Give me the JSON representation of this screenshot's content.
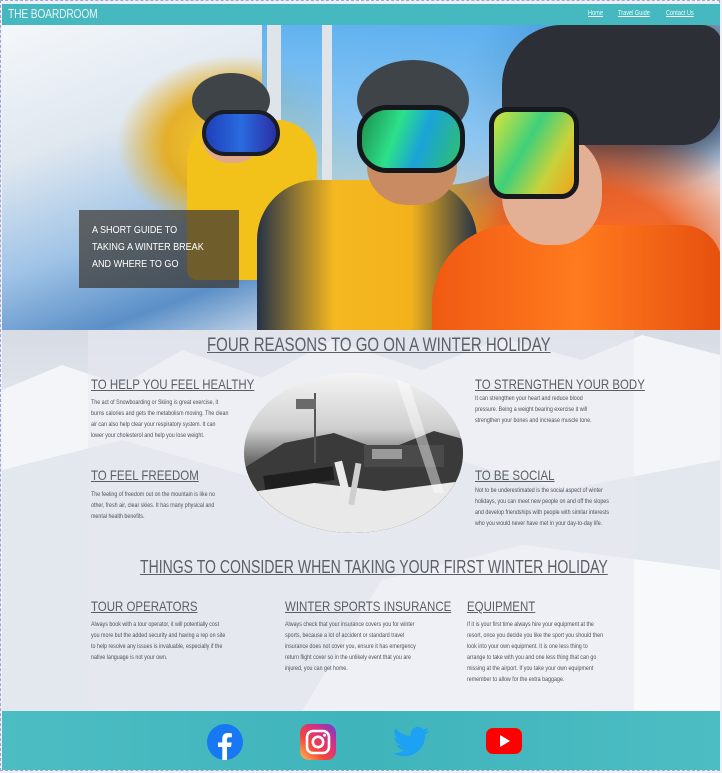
{
  "header": {
    "brand": "THE BOARDROOM",
    "nav": [
      "Home",
      "Travel Guide",
      "Contact Us"
    ]
  },
  "hero": {
    "caption": "A SHORT GUIDE TO TAKING A WINTER BREAK AND WHERE TO GO"
  },
  "reasons": {
    "title": "FOUR REASONS TO GO ON A WINTER HOLIDAY",
    "items": [
      {
        "heading": "TO HELP YOU FEEL HEALTHY",
        "text": "The act of Snowboarding or Skiing is great exercise, it burns calories and gets the metabolism moving. The clean air can also help clear your respiratory system. It can lower your cholesterol and help you lose weight."
      },
      {
        "heading": "TO STRENGTHEN YOUR BODY",
        "text": "It can strengthen your heart and reduce blood pressure. Being a weight bearing exercise it will strengthen your bones and increase muscle tone."
      },
      {
        "heading": "TO FEEL FREEDOM",
        "text": "The feeling of freedom out on the mountain is like no other, fresh air, clear skies. It has many physical and mental health benefits."
      },
      {
        "heading": "TO BE SOCIAL",
        "text": "Not to be underestimated is the social aspect of winter holidays, you can meet new people on and off the slopes and develop friendships with people with similar interests who you would never have met in your day-to-day life."
      }
    ]
  },
  "consider": {
    "title": "THINGS TO CONSIDER WHEN TAKING YOUR FIRST WINTER HOLIDAY",
    "items": [
      {
        "heading": "TOUR OPERATORS",
        "text": "Always book with a tour operator, it will potentially cost you more but the added security and having a rep on site to help resolve any issues is invaluable, especially if the native language is not your own."
      },
      {
        "heading": "WINTER SPORTS INSURANCE",
        "text": "Always check that your insurance covers you for winter sports, because a lot of accident or standard travel insurance does not cover you, ensure it has emergency return flight cover so in the unlikely event that you are injured, you can get home."
      },
      {
        "heading": "EQUIPMENT",
        "text": "If it is your first time always hire your equipment at the resort, once you decide you like the sport you should then look into your own equipment. It is one less thing to arrange to take with you and one less thing that can go missing at the airport. If you take your own equipment remember to allow for the extra baggage."
      }
    ]
  },
  "footer": {
    "social": [
      "facebook-icon",
      "instagram-icon",
      "twitter-icon",
      "youtube-icon"
    ]
  },
  "colors": {
    "header_bg": "#46b8bf",
    "footer_bg": "#4cbdc3",
    "heading_text": "#5a5f66",
    "facebook": "#1877f2",
    "youtube": "#ff0000"
  }
}
